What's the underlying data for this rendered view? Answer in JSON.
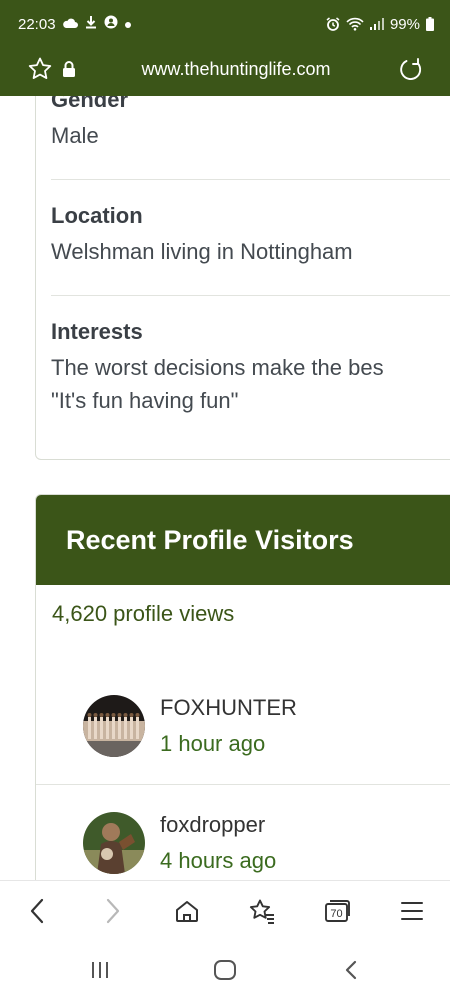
{
  "status": {
    "time": "22:03",
    "battery": "99%"
  },
  "browser": {
    "url": "www.thehuntinglife.com"
  },
  "profile": {
    "fields": [
      {
        "label": "Gender",
        "value": "Male"
      },
      {
        "label": "Location",
        "value": "Welshman living in Nottingham"
      },
      {
        "label": "Interests",
        "value_line1": "The worst decisions make the bes",
        "value_line2": "\"It's fun having fun\""
      }
    ]
  },
  "visitors": {
    "title": "Recent Profile Visitors",
    "views": "4,620 profile views",
    "items": [
      {
        "name": "FOXHUNTER",
        "time": "1 hour ago"
      },
      {
        "name": "foxdropper",
        "time": "4 hours ago"
      }
    ]
  },
  "toolbar": {
    "tab_count": "70"
  },
  "colors": {
    "brand": "#3b5518",
    "accent_text": "#3b6b1f"
  }
}
